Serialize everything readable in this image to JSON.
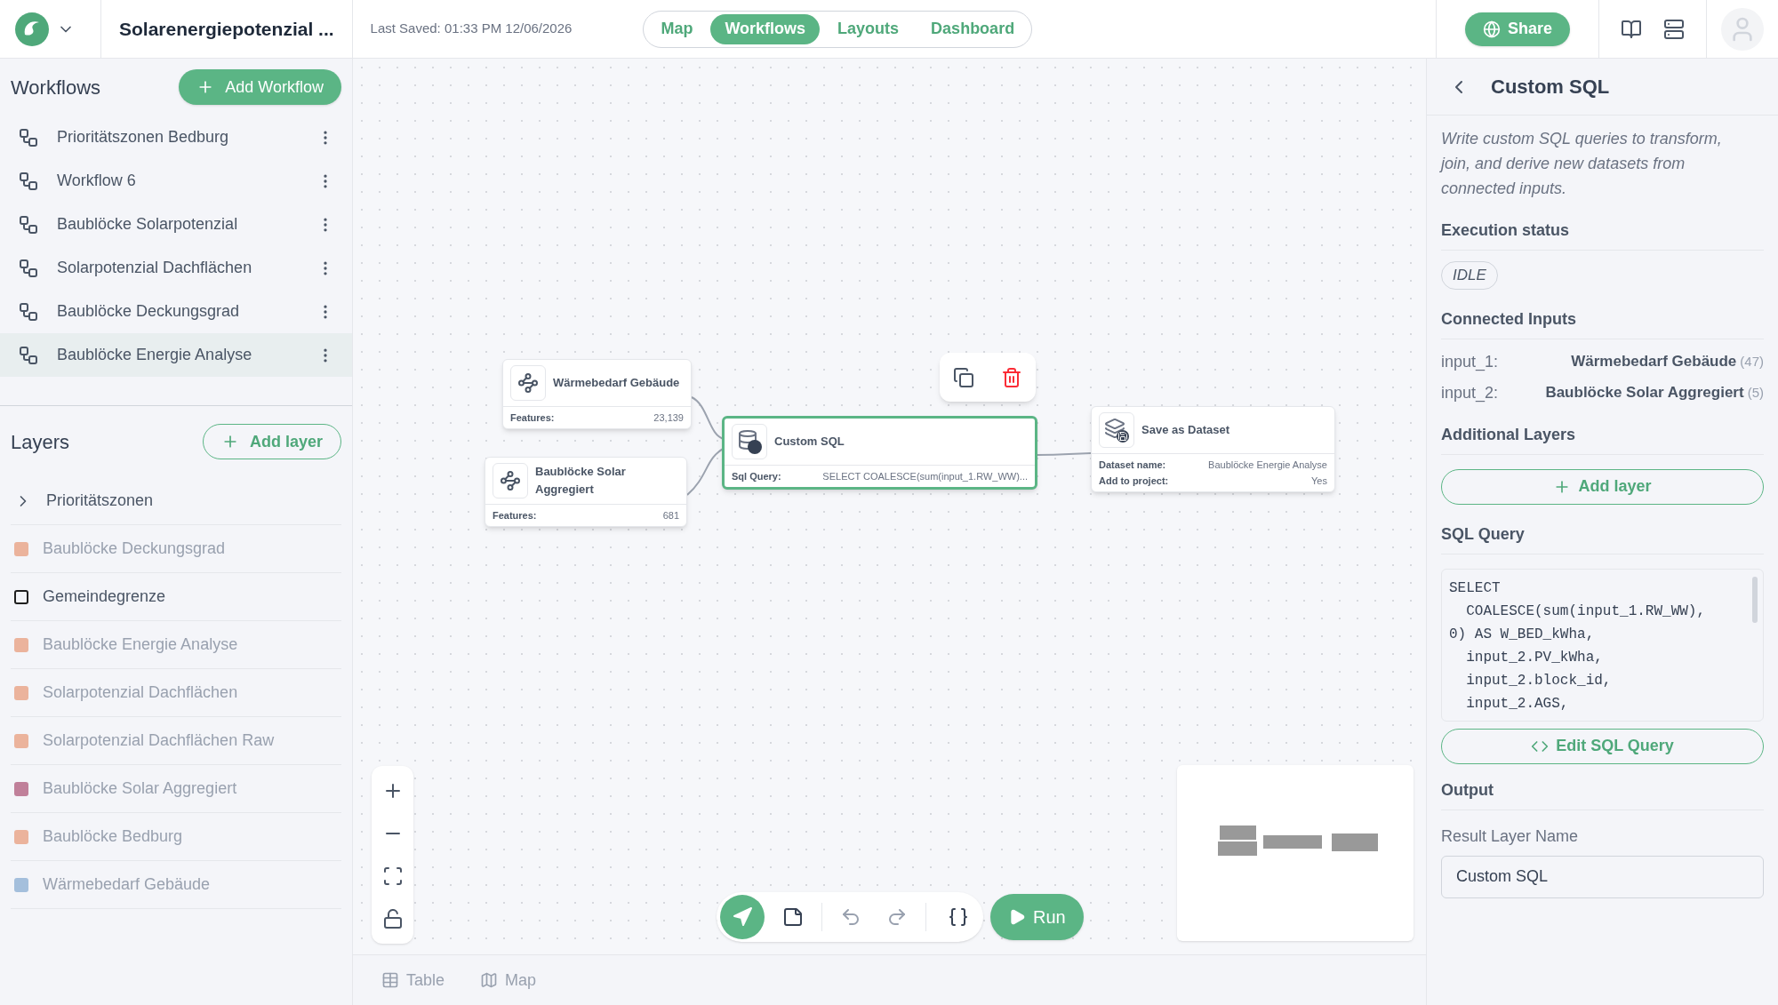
{
  "header": {
    "project_title": "Solarenergiepotenzial ...",
    "last_saved": "Last Saved: 01:33 PM 12/06/2026",
    "tabs": [
      {
        "label": "Map",
        "selected": false
      },
      {
        "label": "Workflows",
        "selected": true
      },
      {
        "label": "Layouts",
        "selected": false
      },
      {
        "label": "Dashboard",
        "selected": false
      }
    ],
    "share_button": "Share"
  },
  "workflows": {
    "title": "Workflows",
    "add_button": "Add Workflow",
    "items": [
      {
        "label": "Prioritätszonen Bedburg",
        "selected": false
      },
      {
        "label": "Workflow 6",
        "selected": false
      },
      {
        "label": "Baublöcke Solarpotenzial",
        "selected": false
      },
      {
        "label": "Solarpotenzial Dachflächen",
        "selected": false
      },
      {
        "label": "Baublöcke Deckungsgrad",
        "selected": false
      },
      {
        "label": "Baublöcke Energie Analyse",
        "selected": true
      }
    ]
  },
  "layers": {
    "title": "Layers",
    "add_button": "Add layer",
    "items": [
      {
        "kind": "group",
        "label": "Prioritätszonen",
        "visible": true
      },
      {
        "kind": "fill",
        "label": "Baublöcke Deckungsgrad",
        "color": "#ebb39c",
        "visible": false
      },
      {
        "kind": "outline",
        "label": "Gemeindegrenze",
        "color": "#1f1f1f",
        "visible": true
      },
      {
        "kind": "fill",
        "label": "Baublöcke Energie Analyse",
        "color": "#ebb39c",
        "visible": false
      },
      {
        "kind": "fill",
        "label": "Solarpotenzial Dachflächen",
        "color": "#ebb39c",
        "visible": false
      },
      {
        "kind": "fill",
        "label": "Solarpotenzial Dachflächen Raw",
        "color": "#ebb39c",
        "visible": false
      },
      {
        "kind": "fill",
        "label": "Baublöcke Solar Aggregiert",
        "color": "#c0809a",
        "visible": false
      },
      {
        "kind": "fill",
        "label": "Baublöcke Bedburg",
        "color": "#ebb39c",
        "visible": false
      },
      {
        "kind": "fill",
        "label": "Wärmebedarf Gebäude",
        "color": "#a4bfdc",
        "visible": false
      }
    ]
  },
  "nodes": [
    {
      "kind": "dataset",
      "title": "Wärmebedarf Gebäude",
      "fields": [
        {
          "label": "Features:",
          "value": "23,139"
        }
      ],
      "selected": false
    },
    {
      "kind": "dataset",
      "title": "Baublöcke Solar Aggregiert",
      "fields": [
        {
          "label": "Features:",
          "value": "681"
        }
      ],
      "selected": false
    },
    {
      "kind": "sql",
      "title": "Custom SQL",
      "fields": [
        {
          "label": "Sql Query:",
          "value": "SELECT COALESCE(sum(input_1.RW_WW)..."
        }
      ],
      "selected": true
    },
    {
      "kind": "save",
      "title": "Save as Dataset",
      "fields": [
        {
          "label": "Dataset name:",
          "value": "Baublöcke Energie Analyse"
        },
        {
          "label": "Add to project:",
          "value": "Yes"
        }
      ],
      "selected": false
    }
  ],
  "toolbar": {
    "run_button": "Run"
  },
  "bottom_tabs": [
    {
      "label": "Table"
    },
    {
      "label": "Map"
    }
  ],
  "panel": {
    "title": "Custom SQL",
    "description": "Write custom SQL queries to transform, join, and derive new datasets from connected inputs.",
    "execution_status": {
      "heading": "Execution status",
      "badge": "IDLE"
    },
    "connected_inputs": {
      "heading": "Connected Inputs",
      "items": [
        {
          "key": "input_1:",
          "name": "Wärmebedarf Gebäude",
          "count": "(47)"
        },
        {
          "key": "input_2:",
          "name": "Baublöcke Solar Aggregiert",
          "count": "(5)"
        }
      ]
    },
    "additional_layers": {
      "heading": "Additional Layers",
      "button": "Add layer"
    },
    "sql_query": {
      "heading": "SQL Query",
      "code": "SELECT\n  COALESCE(sum(input_1.RW_WW),\n0) AS W_BED_kWha,\n  input_2.PV_kWha,\n  input_2.block_id,\n  input_2.AGS,",
      "button": "Edit SQL Query"
    },
    "output": {
      "heading": "Output",
      "field_label": "Result Layer Name",
      "field_value": "Custom SQL"
    }
  }
}
